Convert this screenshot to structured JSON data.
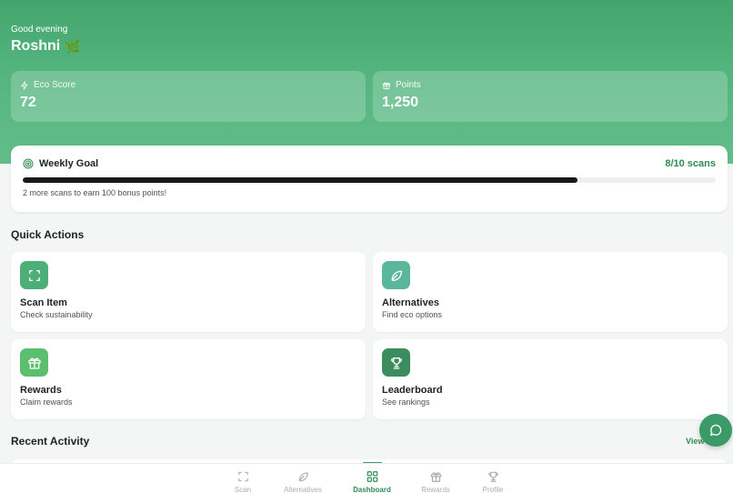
{
  "header": {
    "greeting": "Good evening",
    "username": "Roshni",
    "username_emoji": "🌿"
  },
  "stats": {
    "eco_score": {
      "label": "Eco Score",
      "value": "72"
    },
    "points": {
      "label": "Points",
      "value": "1,250"
    }
  },
  "weekly_goal": {
    "title": "Weekly Goal",
    "count_text": "8/10 scans",
    "progress": 0.8,
    "note": "2 more scans to earn 100 bonus points!"
  },
  "quick_actions": {
    "title": "Quick Actions",
    "items": [
      {
        "name": "Scan Item",
        "subtitle": "Check sustainability",
        "icon": "scan-icon",
        "color": "#4caf78"
      },
      {
        "name": "Alternatives",
        "subtitle": "Find eco options",
        "icon": "leaf-icon",
        "color": "#5bb79a"
      },
      {
        "name": "Rewards",
        "subtitle": "Claim rewards",
        "icon": "gift-icon",
        "color": "#5cbf6f"
      },
      {
        "name": "Leaderboard",
        "subtitle": "See rankings",
        "icon": "trophy-icon",
        "color": "#3b8c5e"
      }
    ]
  },
  "recent_activity": {
    "title": "Recent Activity",
    "view_all": "View"
  },
  "bottom_nav": {
    "items": [
      {
        "label": "Scan",
        "icon": "scan-icon",
        "active": false
      },
      {
        "label": "Alternatives",
        "icon": "leaf-icon",
        "active": false
      },
      {
        "label": "Dashboard",
        "icon": "dashboard-icon",
        "active": true
      },
      {
        "label": "Rewards",
        "icon": "gift-icon",
        "active": false
      },
      {
        "label": "Profile",
        "icon": "trophy-icon",
        "active": false
      }
    ]
  },
  "colors": {
    "brand": "#3a9a68",
    "accent_text": "#2f8a57",
    "progress_fill": "#161a18"
  }
}
